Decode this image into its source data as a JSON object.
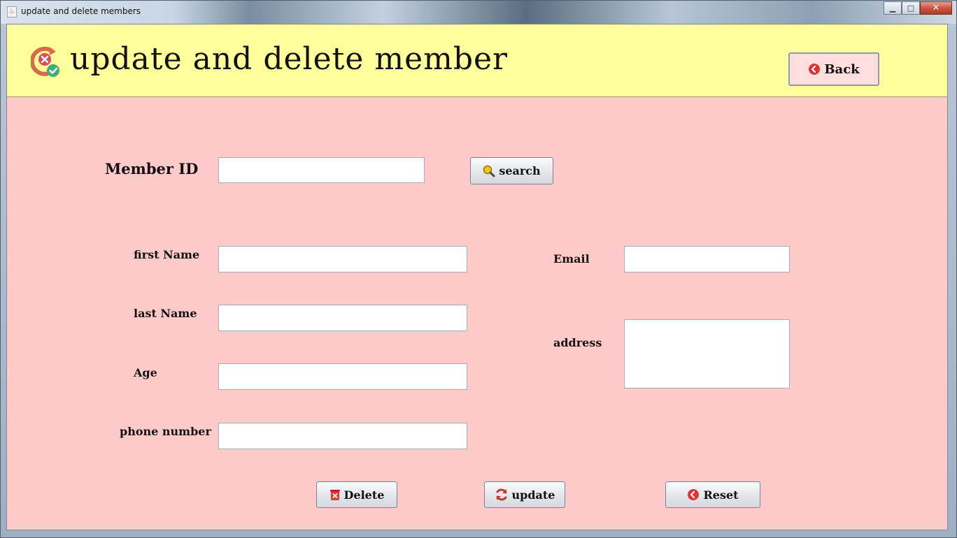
{
  "window": {
    "title": "update and delete members"
  },
  "header": {
    "title": "update and delete member",
    "back_label": "Back"
  },
  "search": {
    "label": "Member ID",
    "value": "",
    "button_label": "search"
  },
  "form": {
    "first_name_label": "first Name",
    "first_name_value": "",
    "last_name_label": "last Name",
    "last_name_value": "",
    "age_label": "Age",
    "age_value": "",
    "phone_label": "phone number",
    "phone_value": "",
    "email_label": "Email",
    "email_value": "",
    "address_label": "address",
    "address_value": ""
  },
  "actions": {
    "delete_label": "Delete",
    "update_label": "update",
    "reset_label": "Reset"
  },
  "colors": {
    "header_bg": "#ffff9c",
    "content_bg": "#ffcaca",
    "back_bg": "#ffdede"
  },
  "icons": {
    "header": "member-update-icon",
    "back": "back-arrow-icon",
    "search": "magnifier-icon",
    "delete": "trash-icon",
    "update": "refresh-icon",
    "reset": "reset-icon"
  }
}
